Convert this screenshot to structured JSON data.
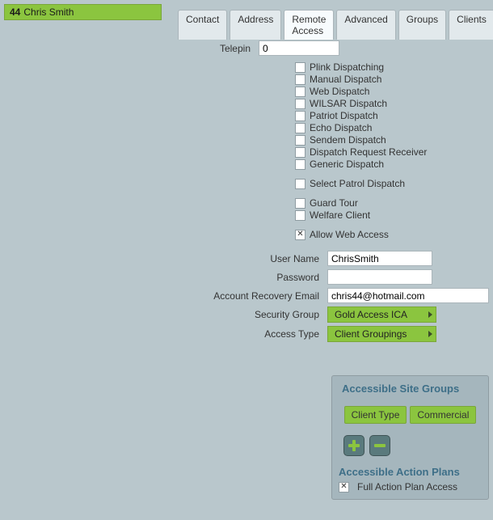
{
  "title": {
    "id": "44",
    "name": "Chris Smith"
  },
  "tabs": [
    "Contact",
    "Address",
    "Remote Access",
    "Advanced",
    "Groups",
    "Clients"
  ],
  "active_tab": 2,
  "telepin": {
    "label": "Telepin",
    "value": "0"
  },
  "dispatch_checks": [
    {
      "label": "Plink Dispatching",
      "checked": false
    },
    {
      "label": "Manual Dispatch",
      "checked": false
    },
    {
      "label": "Web Dispatch",
      "checked": false
    },
    {
      "label": "WILSAR Dispatch",
      "checked": false
    },
    {
      "label": "Patriot Dispatch",
      "checked": false
    },
    {
      "label": "Echo Dispatch",
      "checked": false
    },
    {
      "label": "Sendem Dispatch",
      "checked": false
    },
    {
      "label": "Dispatch Request Receiver",
      "checked": false
    },
    {
      "label": "Generic Dispatch",
      "checked": false
    }
  ],
  "patrol_check": {
    "label": "Select Patrol Dispatch",
    "checked": false
  },
  "guard_checks": [
    {
      "label": "Guard Tour",
      "checked": false
    },
    {
      "label": "Welfare Client",
      "checked": false
    }
  ],
  "allow_web": {
    "label": "Allow Web Access",
    "checked": true
  },
  "username": {
    "label": "User Name",
    "value": "ChrisSmith"
  },
  "password": {
    "label": "Password",
    "value": ""
  },
  "email": {
    "label": "Account Recovery Email",
    "value": "chris44@hotmail.com"
  },
  "security_group": {
    "label": "Security Group",
    "value": "Gold Access ICA"
  },
  "access_type": {
    "label": "Access Type",
    "value": "Client Groupings"
  },
  "panel": {
    "title": "Accessible Site Groups",
    "buttons": {
      "client_type": "Client Type",
      "commercial": "Commercial"
    },
    "sub_title": "Accessible Action Plans",
    "sub_check": {
      "label": "Full Action Plan Access",
      "checked": true
    }
  }
}
